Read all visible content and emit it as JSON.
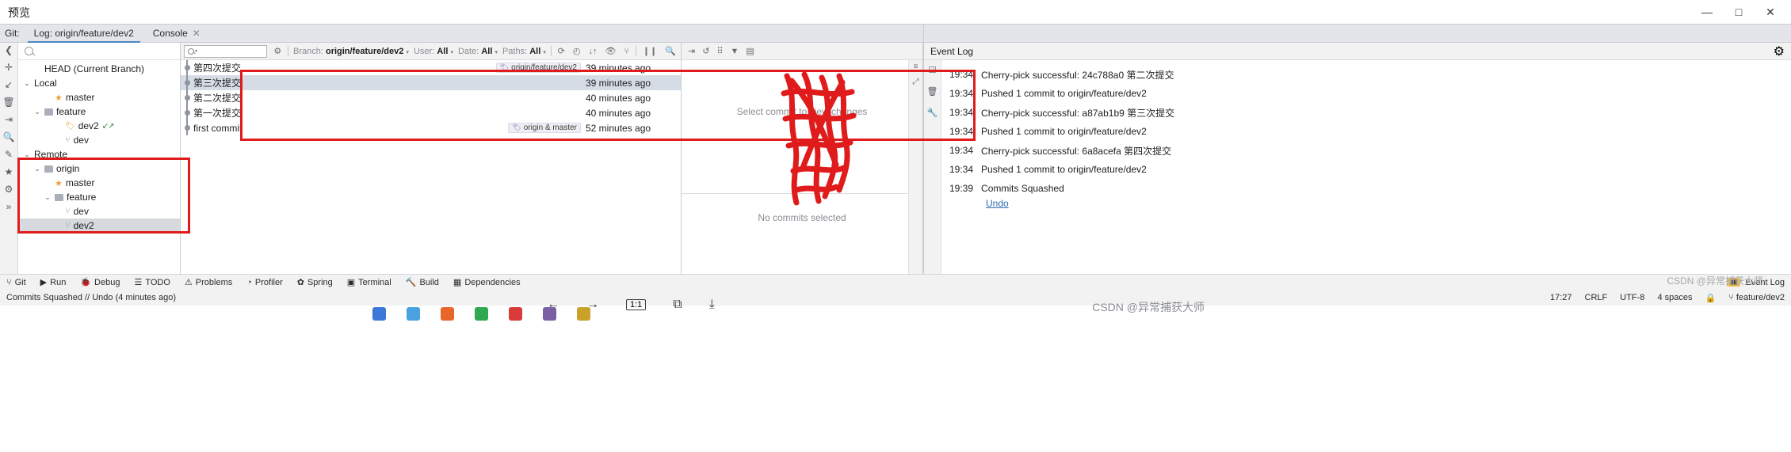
{
  "window": {
    "preview_label": "预览",
    "minimize": "—",
    "maximize": "□",
    "close": "✕"
  },
  "tabs": {
    "git_label": "Git:",
    "items": [
      {
        "label": "Log: origin/feature/dev2",
        "active": true,
        "closable": false
      },
      {
        "label": "Console",
        "active": false,
        "closable": true,
        "close_glyph": "✕"
      }
    ]
  },
  "left_rail": {
    "icons": [
      "collapse-icon",
      "add-icon",
      "checkout-icon",
      "delete-icon",
      "merge-icon",
      "search-icon",
      "edit-icon",
      "star-icon",
      "settings-icon",
      "more-icon"
    ],
    "glyphs": [
      "❮",
      "✛",
      "↙",
      "🗑",
      "⇥",
      "🔍",
      "✎",
      "★",
      "⚙",
      "»"
    ]
  },
  "branch_tree": {
    "search_placeholder": "",
    "nodes": [
      {
        "label": "HEAD (Current Branch)",
        "indent": 1,
        "chev": "",
        "icon": "none",
        "selected": false
      },
      {
        "label": "Local",
        "indent": 0,
        "chev": "⌄",
        "icon": "none",
        "selected": false
      },
      {
        "label": "master",
        "indent": 2,
        "chev": "",
        "icon": "star",
        "selected": false
      },
      {
        "label": "feature",
        "indent": 1,
        "chev": "⌄",
        "icon": "folder",
        "selected": false
      },
      {
        "label": "dev2",
        "indent": 3,
        "chev": "",
        "icon": "tag",
        "selected": false,
        "arrows": "↙↗"
      },
      {
        "label": "dev",
        "indent": 3,
        "chev": "",
        "icon": "branch",
        "selected": false
      },
      {
        "label": "Remote",
        "indent": 0,
        "chev": "⌄",
        "icon": "none",
        "selected": false
      },
      {
        "label": "origin",
        "indent": 1,
        "chev": "⌄",
        "icon": "folder",
        "selected": false
      },
      {
        "label": "master",
        "indent": 2,
        "chev": "",
        "icon": "star",
        "selected": false
      },
      {
        "label": "feature",
        "indent": 2,
        "chev": "⌄",
        "icon": "folder",
        "selected": false
      },
      {
        "label": "dev",
        "indent": 3,
        "chev": "",
        "icon": "branch",
        "selected": false
      },
      {
        "label": "dev2",
        "indent": 3,
        "chev": "",
        "icon": "branch",
        "selected": true
      }
    ]
  },
  "commit_filters": {
    "search_value": "",
    "branch": {
      "prefix": "Branch: ",
      "value": "origin/feature/dev2",
      "caret": "▾"
    },
    "user": {
      "prefix": "User: ",
      "value": "All",
      "caret": "▾"
    },
    "date": {
      "prefix": "Date: ",
      "value": "All",
      "caret": "▾"
    },
    "paths": {
      "prefix": "Paths: ",
      "value": "All",
      "caret": "▾"
    },
    "toolbar_icons": [
      "refresh-icon",
      "collapse-graph-icon",
      "sort-icon",
      "eye-icon",
      "intellisort-icon",
      "pause-icon",
      "search-icon"
    ],
    "toolbar_glyphs": [
      "⟳",
      "◴",
      "↓↑",
      "👁",
      "⑂",
      "❙❙",
      "🔍"
    ]
  },
  "commits": {
    "rows": [
      {
        "subject": "第四次提交",
        "tag": "origin/feature/dev2",
        "tag_icon": "branch-label-icon",
        "time": "39 minutes ago",
        "selected": false
      },
      {
        "subject": "第三次提交",
        "tag": "",
        "tag_icon": "",
        "time": "39 minutes ago",
        "selected": true
      },
      {
        "subject": "第二次提交",
        "tag": "",
        "tag_icon": "",
        "time": "40 minutes ago",
        "selected": false
      },
      {
        "subject": "第一次提交",
        "tag": "",
        "tag_icon": "",
        "time": "40 minutes ago",
        "selected": false
      },
      {
        "subject": "first commit",
        "tag": "origin & master",
        "tag_icon": "branch-label-icon",
        "time": "52 minutes ago",
        "selected": false
      }
    ]
  },
  "changes_panel": {
    "toolbar_icons": [
      "expand-icon",
      "revert-icon",
      "group-icon",
      "filter-icon",
      "list-icon"
    ],
    "toolbar_glyphs": [
      "⇥",
      "↺",
      "⠿",
      "▼",
      "▤"
    ],
    "empty_top": "Select commit to view changes",
    "empty_bottom": "No commits selected",
    "rail_glyphs": [
      "≡",
      "⤢"
    ]
  },
  "event_log": {
    "title": "Event Log",
    "settings_icon": "gear-icon",
    "settings_glyph": "⚙",
    "rail_glyphs": [
      "☑",
      "🗑",
      "🔧"
    ],
    "entries": [
      {
        "time": "19:34",
        "message": "Cherry-pick successful: 24c788a0 第二次提交"
      },
      {
        "time": "19:34",
        "message": "Pushed 1 commit to origin/feature/dev2"
      },
      {
        "time": "19:34",
        "message": "Cherry-pick successful: a87ab1b9 第三次提交"
      },
      {
        "time": "19:34",
        "message": "Pushed 1 commit to origin/feature/dev2"
      },
      {
        "time": "19:34",
        "message": "Cherry-pick successful: 6a8acefa 第四次提交"
      },
      {
        "time": "19:34",
        "message": "Pushed 1 commit to origin/feature/dev2"
      },
      {
        "time": "19:39",
        "message": "Commits Squashed"
      }
    ],
    "undo_link": "Undo"
  },
  "ide_toolwindows": {
    "items": [
      {
        "label": "Git",
        "glyph": "⑂"
      },
      {
        "label": "Run",
        "glyph": "▶"
      },
      {
        "label": "Debug",
        "glyph": "🐞"
      },
      {
        "label": "TODO",
        "glyph": "☰"
      },
      {
        "label": "Problems",
        "glyph": "⚠"
      },
      {
        "label": "Profiler",
        "glyph": "◔"
      },
      {
        "label": "Spring",
        "glyph": "✿"
      },
      {
        "label": "Terminal",
        "glyph": "▣"
      },
      {
        "label": "Build",
        "glyph": "🔨"
      },
      {
        "label": "Dependencies",
        "glyph": "▦"
      }
    ],
    "event_log_button": "Event Log",
    "event_log_glyph": "▣"
  },
  "status_bar": {
    "message": "Commits Squashed // Undo (4 minutes ago)",
    "position": "17:27",
    "line_separator": "CRLF",
    "encoding": "UTF-8",
    "indent": "4 spaces",
    "branch": "feature/dev2",
    "branch_glyph": "⑂",
    "lock_glyph": "🔒"
  },
  "preview_controls": {
    "back_glyph": "←",
    "forward_glyph": "→",
    "zoom_label": "1:1",
    "copy_glyph": "⧉",
    "download_glyph": "⤓"
  },
  "watermarks": {
    "main": "CSDN @异常捕获大师",
    "secondary": "CSDN @异常捕获大师"
  },
  "annotations": {
    "color": "#e01b1b",
    "boxes": [
      "remote-branches-box",
      "commit-list-box"
    ],
    "scribble": "red-scribble-over-commit-hashes"
  }
}
